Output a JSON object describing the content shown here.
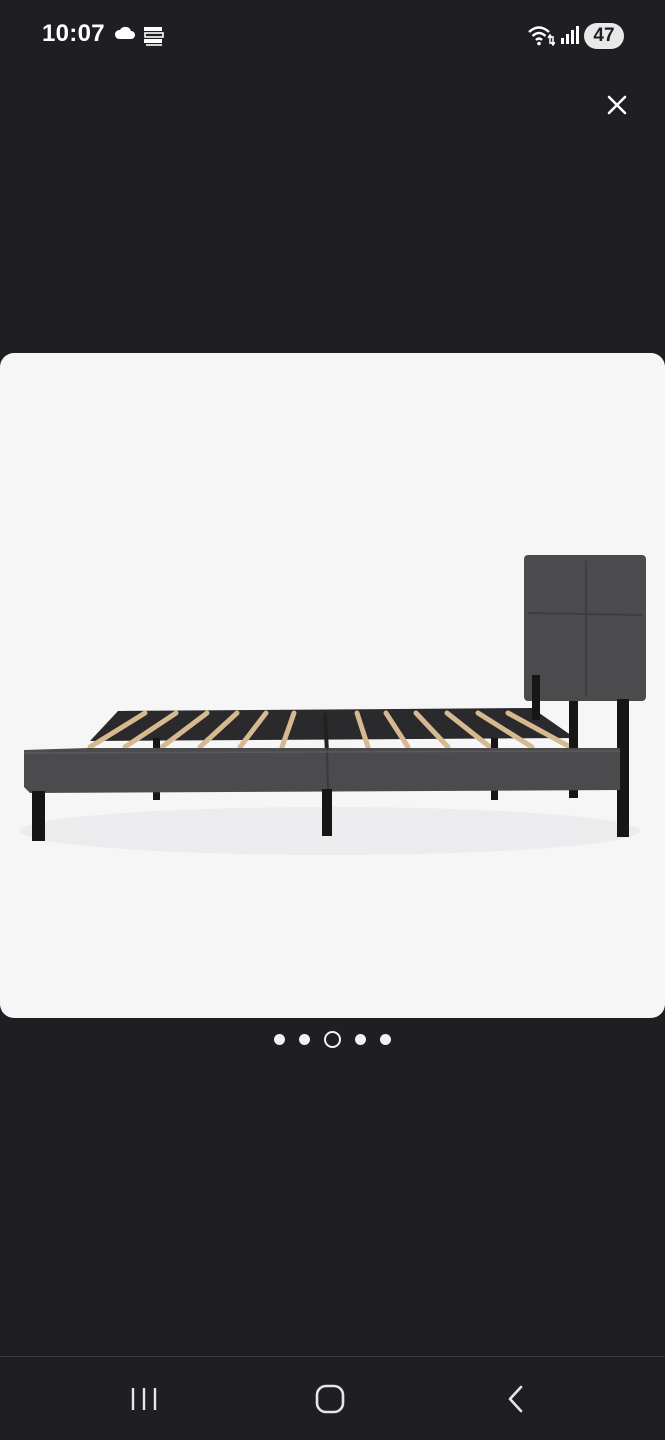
{
  "status_bar": {
    "time": "10:07",
    "battery": "47",
    "icons": [
      "cloud-icon",
      "stack-icon",
      "wifi-icon",
      "signal-icon"
    ]
  },
  "viewer": {
    "close_icon": "close-icon",
    "image": "product-image-platform-bed",
    "pagination": {
      "total": 5,
      "active_index": 2
    }
  },
  "nav_bar": {
    "buttons": [
      "recent-apps-icon",
      "home-icon",
      "back-icon"
    ]
  },
  "colors": {
    "background": "#1f1e23",
    "image_bg": "#f6f6f7",
    "bed_fabric": "#4b4a4c",
    "slats": "#d6b891",
    "legs": "#161616"
  }
}
